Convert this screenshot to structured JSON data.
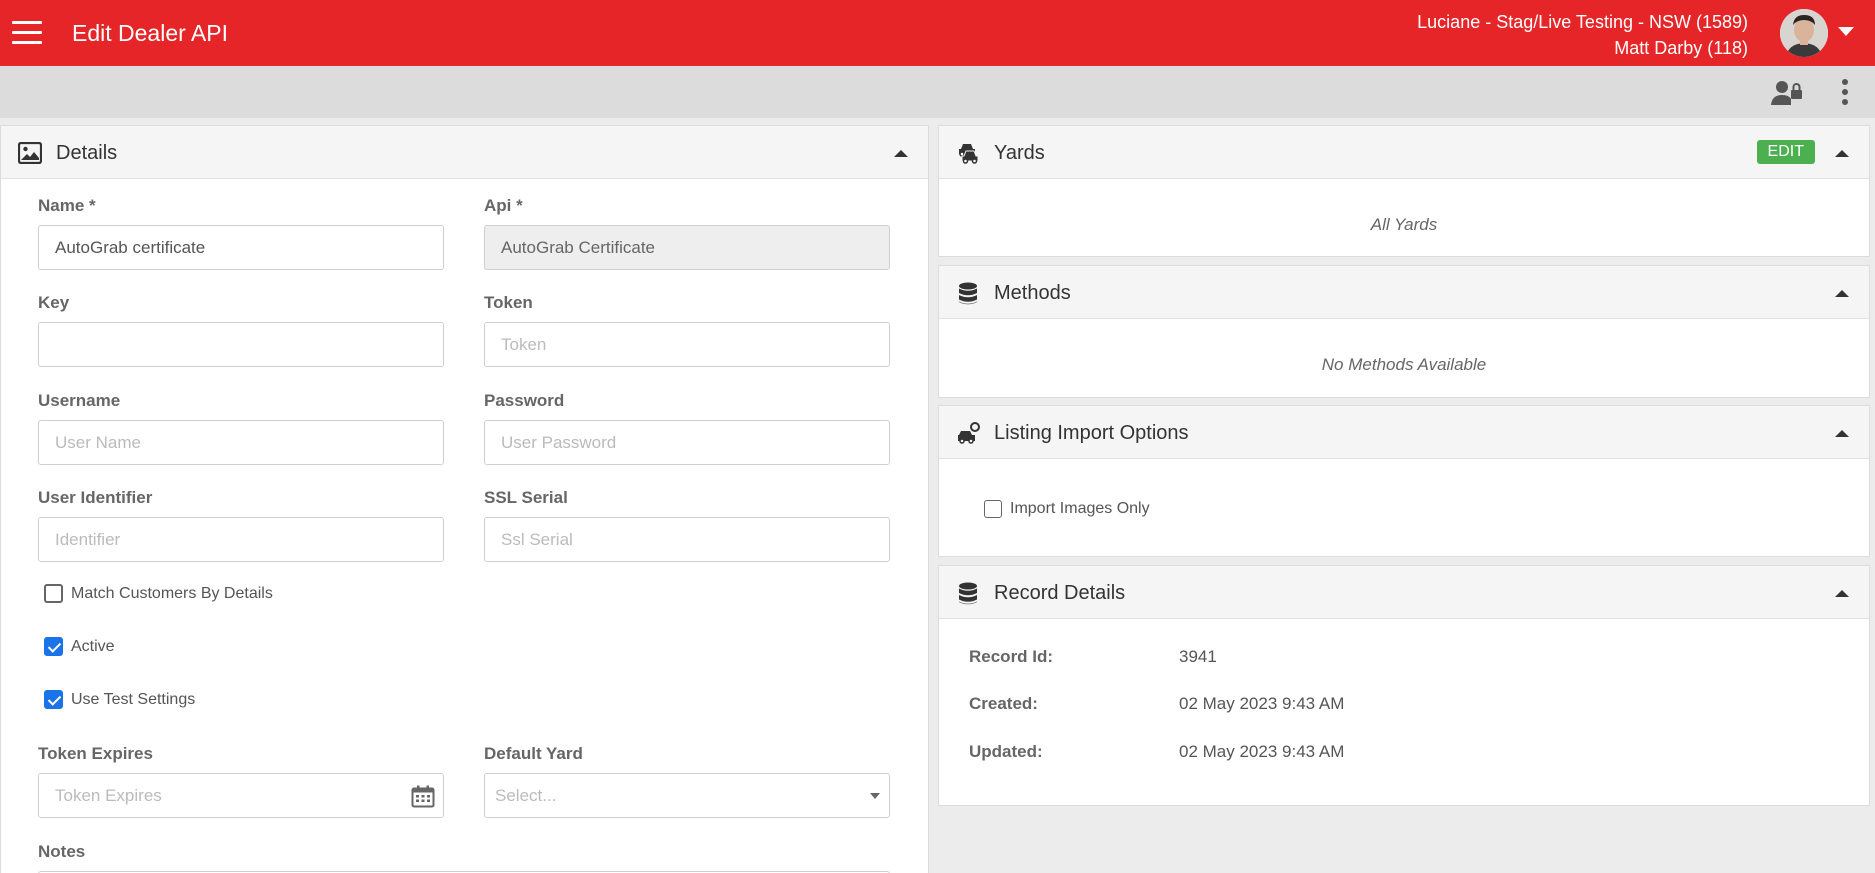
{
  "header": {
    "title": "Edit Dealer API",
    "account_line": "Luciane - Stag/Live Testing - NSW (1589)",
    "user_line": "Matt Darby (118)"
  },
  "colors": {
    "brand": "#e52527",
    "edit": "#4cb050",
    "checkbox": "#1a73e8"
  },
  "details": {
    "title": "Details",
    "name_label": "Name *",
    "name_value": "AutoGrab certificate",
    "api_label": "Api *",
    "api_value": "AutoGrab Certificate",
    "key_label": "Key",
    "key_value": "",
    "token_label": "Token",
    "token_placeholder": "Token",
    "username_label": "Username",
    "username_placeholder": "User Name",
    "password_label": "Password",
    "password_placeholder": "User Password",
    "user_identifier_label": "User Identifier",
    "user_identifier_placeholder": "Identifier",
    "ssl_serial_label": "SSL Serial",
    "ssl_serial_placeholder": "Ssl Serial",
    "match_customers_label": "Match Customers By Details",
    "active_label": "Active",
    "use_test_settings_label": "Use Test Settings",
    "token_expires_label": "Token Expires",
    "token_expires_placeholder": "Token Expires",
    "default_yard_label": "Default Yard",
    "default_yard_placeholder": "Select...",
    "notes_label": "Notes"
  },
  "yards": {
    "title": "Yards",
    "edit_label": "EDIT",
    "empty_text": "All Yards"
  },
  "methods": {
    "title": "Methods",
    "empty_text": "No Methods Available"
  },
  "listing_import": {
    "title": "Listing Import Options",
    "import_images_label": "Import Images Only"
  },
  "record": {
    "title": "Record Details",
    "id_label": "Record Id:",
    "id_value": "3941",
    "created_label": "Created:",
    "created_value": "02 May 2023 9:43 AM",
    "updated_label": "Updated:",
    "updated_value": "02 May 2023 9:43 AM"
  }
}
